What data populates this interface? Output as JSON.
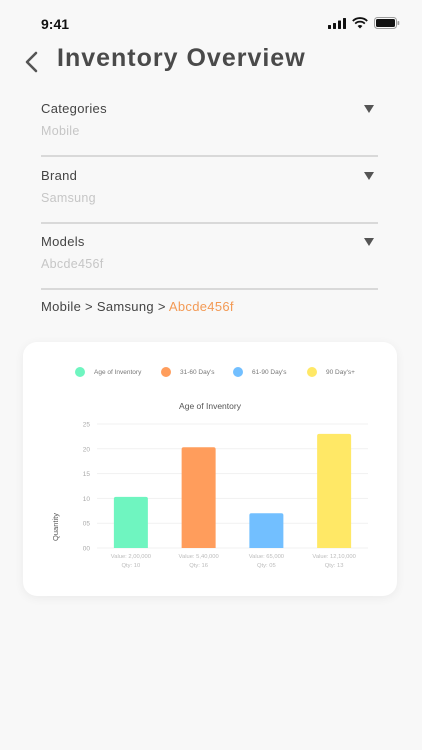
{
  "status": {
    "time": "9:41"
  },
  "header": {
    "title": "Inventory Overview"
  },
  "filters": [
    {
      "label": "Categories",
      "value": "Mobile"
    },
    {
      "label": "Brand",
      "value": "Samsung"
    },
    {
      "label": "Models",
      "value": "Abcde456f"
    }
  ],
  "breadcrumb": {
    "items": [
      "Mobile",
      "Samsung"
    ],
    "separator": ">",
    "active": "Abcde456f"
  },
  "legend": [
    {
      "label": "Age of Inventory",
      "color": "#6ff5c0"
    },
    {
      "label": "31-60 Day's",
      "color": "#ff9d5c"
    },
    {
      "label": "61-90 Day's",
      "color": "#72bfff"
    },
    {
      "label": "90 Day's+",
      "color": "#ffe866"
    }
  ],
  "chart_data": {
    "type": "bar",
    "title": "Age of Inventory",
    "ylabel": "Quantity",
    "xlabel": "",
    "ylim": [
      0,
      25
    ],
    "yticks": [
      "00",
      "05",
      "10",
      "15",
      "20",
      "25"
    ],
    "categories": [
      {
        "value_label": "Value: 2,00,000",
        "qty_label": "Qty: 10"
      },
      {
        "value_label": "Value: 5,40,000",
        "qty_label": "Qty: 16"
      },
      {
        "value_label": "Value: 65,000",
        "qty_label": "Qty: 05"
      },
      {
        "value_label": "Value: 12,10,000",
        "qty_label": "Qty: 13"
      }
    ],
    "values": [
      10.3,
      20.3,
      7,
      23
    ],
    "colors": [
      "#6ff5c0",
      "#ff9d5c",
      "#72bfff",
      "#ffe866"
    ],
    "grid": true
  }
}
